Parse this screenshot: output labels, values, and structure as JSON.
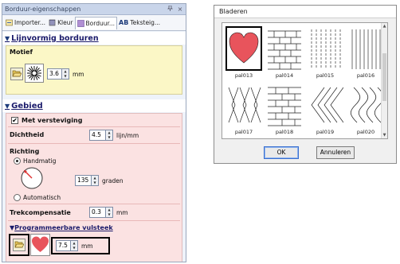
{
  "panel": {
    "title": "Borduur-eigenschappen",
    "pin": "%",
    "close": "×",
    "tabs": [
      {
        "label": "Importer..."
      },
      {
        "label": "Kleur"
      },
      {
        "label": "Borduur..."
      },
      {
        "label": "Teksteig..."
      }
    ],
    "tab_ab": "AB",
    "lijnvormig": {
      "heading": "Lijnvormig borduren",
      "motief_label": "Motief",
      "size_value": "3.6",
      "unit": "mm"
    },
    "gebied": {
      "heading": "Gebied",
      "verstevinging_label": "Met versteviging",
      "verstevinging_checked": true,
      "dichtheid_label": "Dichtheid",
      "dichtheid_value": "4.5",
      "dichtheid_unit": "lijn/mm",
      "richting_label": "Richting",
      "handmatig_label": "Handmatig",
      "graden_value": "135",
      "graden_unit": "graden",
      "automatisch_label": "Automatisch",
      "trek_label": "Trekcompensatie",
      "trek_value": "0.3",
      "trek_unit": "mm",
      "prog_heading": "Programmeerbare vulsteek",
      "prog_size_value": "7.5",
      "prog_unit": "mm"
    },
    "check_mark": "✔"
  },
  "dialog": {
    "title": "Bladeren",
    "patterns": [
      {
        "name": "pal013"
      },
      {
        "name": "pal014"
      },
      {
        "name": "pal015"
      },
      {
        "name": "pal016"
      },
      {
        "name": "pal017"
      },
      {
        "name": "pal018"
      },
      {
        "name": "pal019"
      },
      {
        "name": "pal020"
      }
    ],
    "ok_label": "OK",
    "cancel_label": "Annuleren"
  },
  "colors": {
    "heart": "#e8545c",
    "motif_bg": "#fbf7c6",
    "area_bg": "#fbe2e2"
  }
}
